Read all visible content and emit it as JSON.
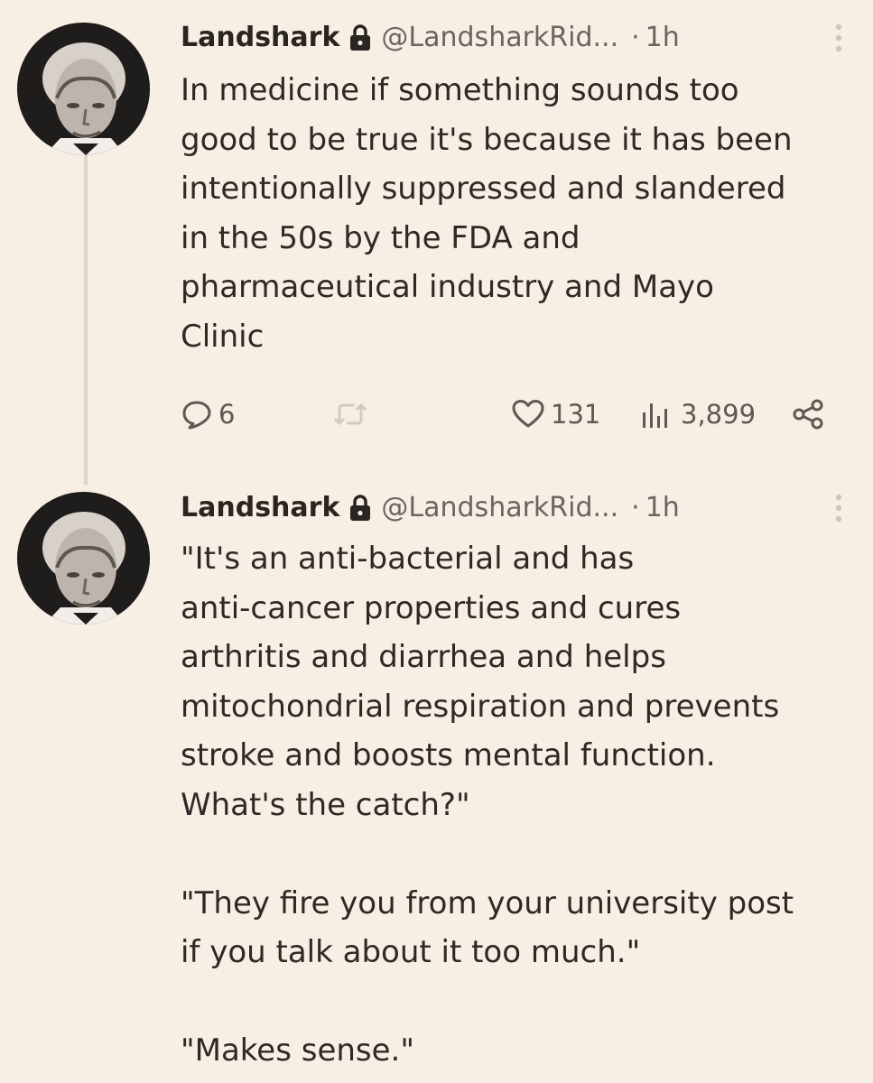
{
  "tweets": [
    {
      "author_name": "Landshark",
      "handle": "@LandsharkRid...",
      "separator": "·",
      "time": "1h",
      "text": "In medicine if something sounds too\ngood to be true it's because it has been\nintentionally suppressed and slandered\nin the 50s by the FDA and\npharmaceutical industry and Mayo\nClinic",
      "actions": {
        "replies": "6",
        "retweets": "",
        "likes": "131",
        "views": "3,899"
      }
    },
    {
      "author_name": "Landshark",
      "handle": "@LandsharkRid...",
      "separator": "·",
      "time": "1h",
      "text": "\"It's an anti-bacterial and has\nanti-cancer properties and cures\narthritis and diarrhea and helps\nmitochondrial respiration and prevents\nstroke and boosts mental function.\nWhat's the catch?\"\n\n\"They fire you from your university post\nif you talk about it too much.\"\n\n\"Makes sense.\""
    }
  ],
  "icons": {
    "lock": "lock-icon",
    "more": "more-vertical-icon",
    "reply": "reply-icon",
    "retweet": "retweet-icon",
    "like": "heart-icon",
    "views": "views-icon",
    "share": "share-icon"
  },
  "colors": {
    "background": "#f8efe4",
    "text": "#2e2925",
    "secondary_text": "#6b6460",
    "thread_line": "#ddd5cb"
  }
}
